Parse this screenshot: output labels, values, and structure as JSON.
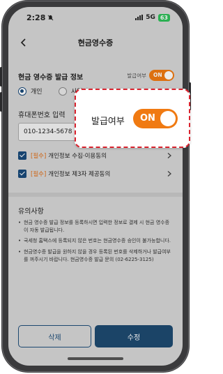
{
  "status_bar": {
    "time": "2:28",
    "network": "5G",
    "battery": "63"
  },
  "header": {
    "title": "현금영수증"
  },
  "issue_info": {
    "title": "현금 영수증 발급 정보",
    "toggle_label": "발급여부",
    "toggle_state": "ON",
    "options": [
      {
        "label": "개인",
        "selected": true
      },
      {
        "label": "사업자",
        "selected": false
      }
    ]
  },
  "phone": {
    "label": "휴대폰번호 입력",
    "value": "010-1234-5678"
  },
  "agreements": [
    {
      "required": "[필수]",
      "label": "개인정보 수집·이용동의",
      "checked": true
    },
    {
      "required": "[필수]",
      "label": "개인정보 제3자 제공동의",
      "checked": true
    }
  ],
  "notice": {
    "title": "유의사항",
    "items": [
      "현금 영수증 발급 정보를 등록하시면 입력한 정보로 결제 시 현금 영수증이 자동 발급됩니다.",
      "국세청 홈택스에 등록되지 않은 번호는 현금영수증 승인이 불가능합니다.",
      "현금영수증 발급을 원하지 않을 경우 등록된 번호를 삭제하거나 발급여부를 꺼주시기 바랍니다. 현금영수증 발급 문의 (02-6225-3125)"
    ]
  },
  "buttons": {
    "delete": "삭제",
    "edit": "수정"
  },
  "zoom_callout": {
    "label": "발급여부",
    "toggle_state": "ON"
  },
  "colors": {
    "accent_orange": "#f07a12",
    "primary_navy": "#1e4a70",
    "callout_border": "#d9232e"
  }
}
